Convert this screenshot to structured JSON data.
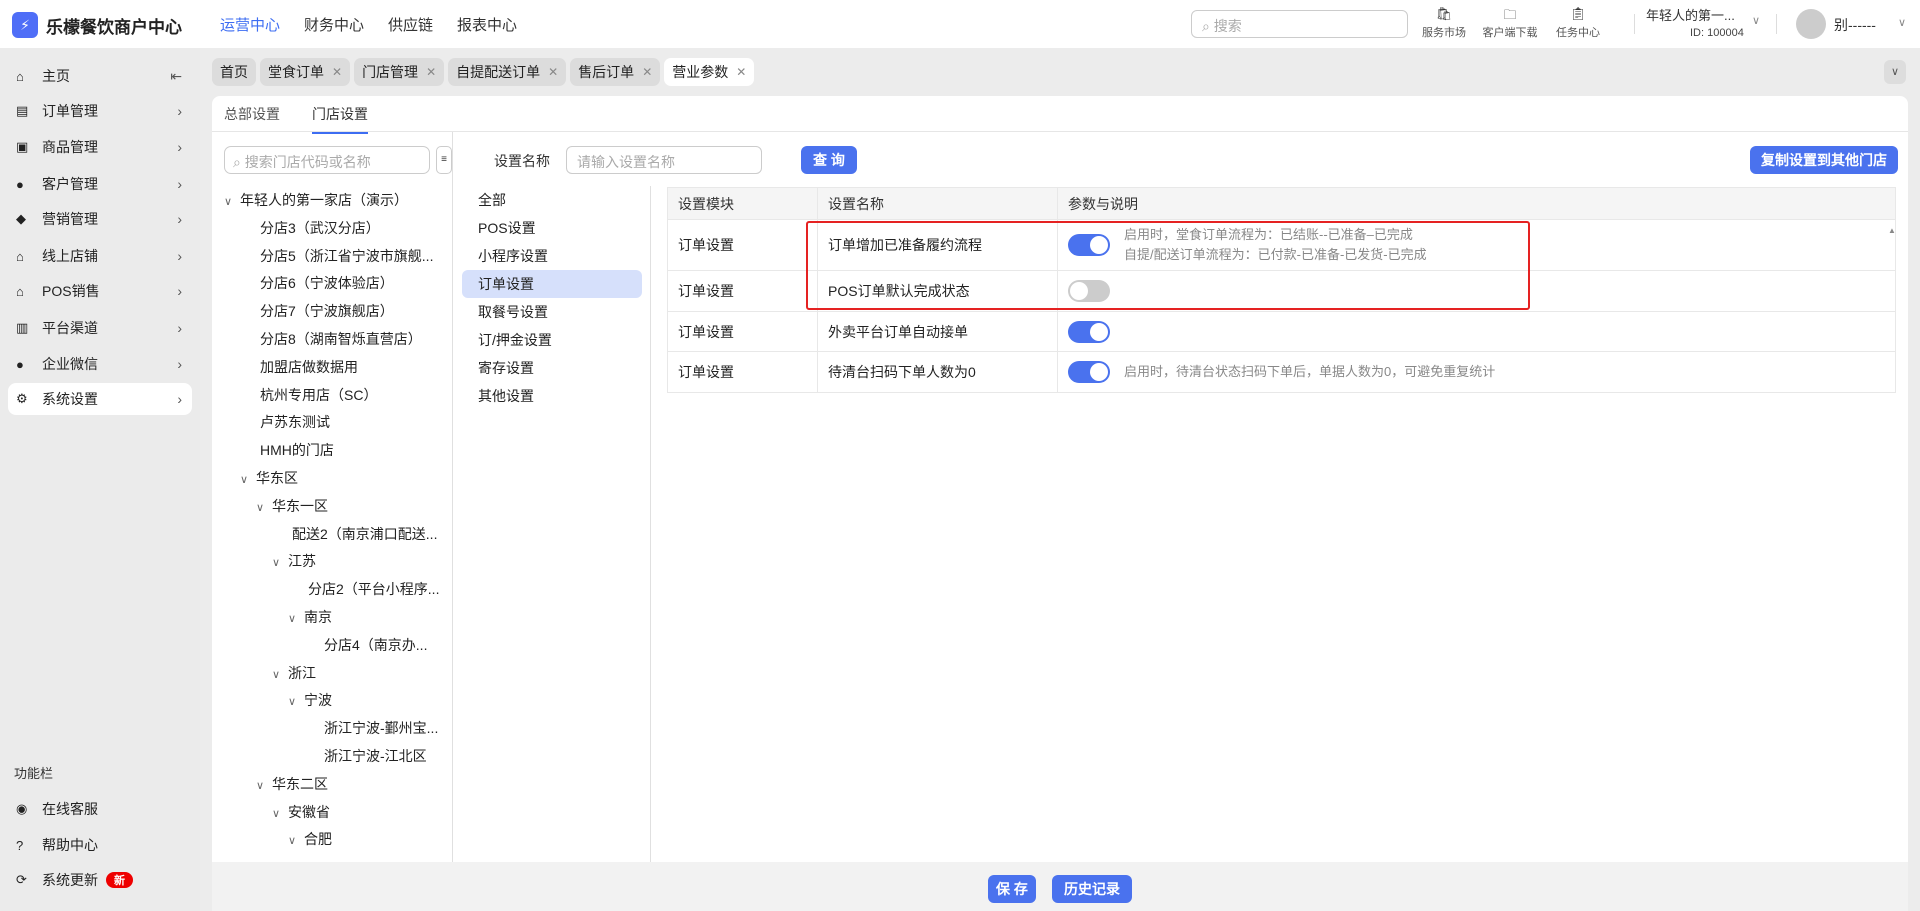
{
  "header": {
    "brand": "乐檬餐饮商户中心",
    "nav": [
      "运营中心",
      "财务中心",
      "供应链",
      "报表中心"
    ],
    "search_placeholder": "搜索",
    "tools": [
      "服务市场",
      "客户端下载",
      "任务中心"
    ],
    "store_name": "年轻人的第一...",
    "store_id": "ID: 100004",
    "user": "别------"
  },
  "sidebar": {
    "items": [
      "主页",
      "订单管理",
      "商品管理",
      "客户管理",
      "营销管理",
      "线上店铺",
      "POS销售",
      "平台渠道",
      "企业微信",
      "系统设置"
    ],
    "func_title": "功能栏",
    "func_items": [
      "在线客服",
      "帮助中心",
      "系统更新"
    ],
    "new_badge": "新"
  },
  "tabs": [
    "首页",
    "堂食订单",
    "门店管理",
    "自提配送订单",
    "售后订单",
    "营业参数"
  ],
  "subtabs": [
    "总部设置",
    "门店设置"
  ],
  "tree": {
    "search_placeholder": "搜索门店代码或名称",
    "nodes": [
      "年轻人的第一家店（演示）",
      "分店3（武汉分店）",
      "分店5（浙江省宁波市旗舰...",
      "分店6（宁波体验店）",
      "分店7（宁波旗舰店）",
      "分店8（湖南智烁直营店）",
      "加盟店做数据用",
      "杭州专用店（SC）",
      "卢苏东测试",
      "HMH的门店",
      "华东区",
      "华东一区",
      "配送2（南京浦口配送...",
      "江苏",
      "分店2（平台小程序...",
      "南京",
      "分店4（南京办...",
      "浙江",
      "宁波",
      "浙江宁波-鄞州宝...",
      "浙江宁波-江北区",
      "华东二区",
      "安徽省",
      "合肥"
    ]
  },
  "categories": [
    "全部",
    "POS设置",
    "小程序设置",
    "订单设置",
    "取餐号设置",
    "订/押金设置",
    "寄存设置",
    "其他设置"
  ],
  "filter": {
    "label": "设置名称",
    "placeholder": "请输入设置名称",
    "query": "查 询",
    "copy": "复制设置到其他门店"
  },
  "table": {
    "headers": [
      "设置模块",
      "设置名称",
      "参数与说明"
    ],
    "rows": [
      {
        "module": "订单设置",
        "name": "订单增加已准备履约流程",
        "enabled": true,
        "desc1": "启用时，堂食订单流程为：已结账--已准备–已完成",
        "desc2": "自提/配送订单流程为：已付款-已准备-已发货-已完成"
      },
      {
        "module": "订单设置",
        "name": "POS订单默认完成状态",
        "enabled": false
      },
      {
        "module": "订单设置",
        "name": "外卖平台订单自动接单",
        "enabled": true
      },
      {
        "module": "订单设置",
        "name": "待清台扫码下单人数为0",
        "enabled": true,
        "desc1": "启用时，待清台状态扫码下单后，单据人数为0，可避免重复统计"
      }
    ]
  },
  "footer": {
    "save": "保 存",
    "history": "历史记录"
  },
  "colors": {
    "accent": "#4a72ee",
    "highlight": "#e52222"
  }
}
